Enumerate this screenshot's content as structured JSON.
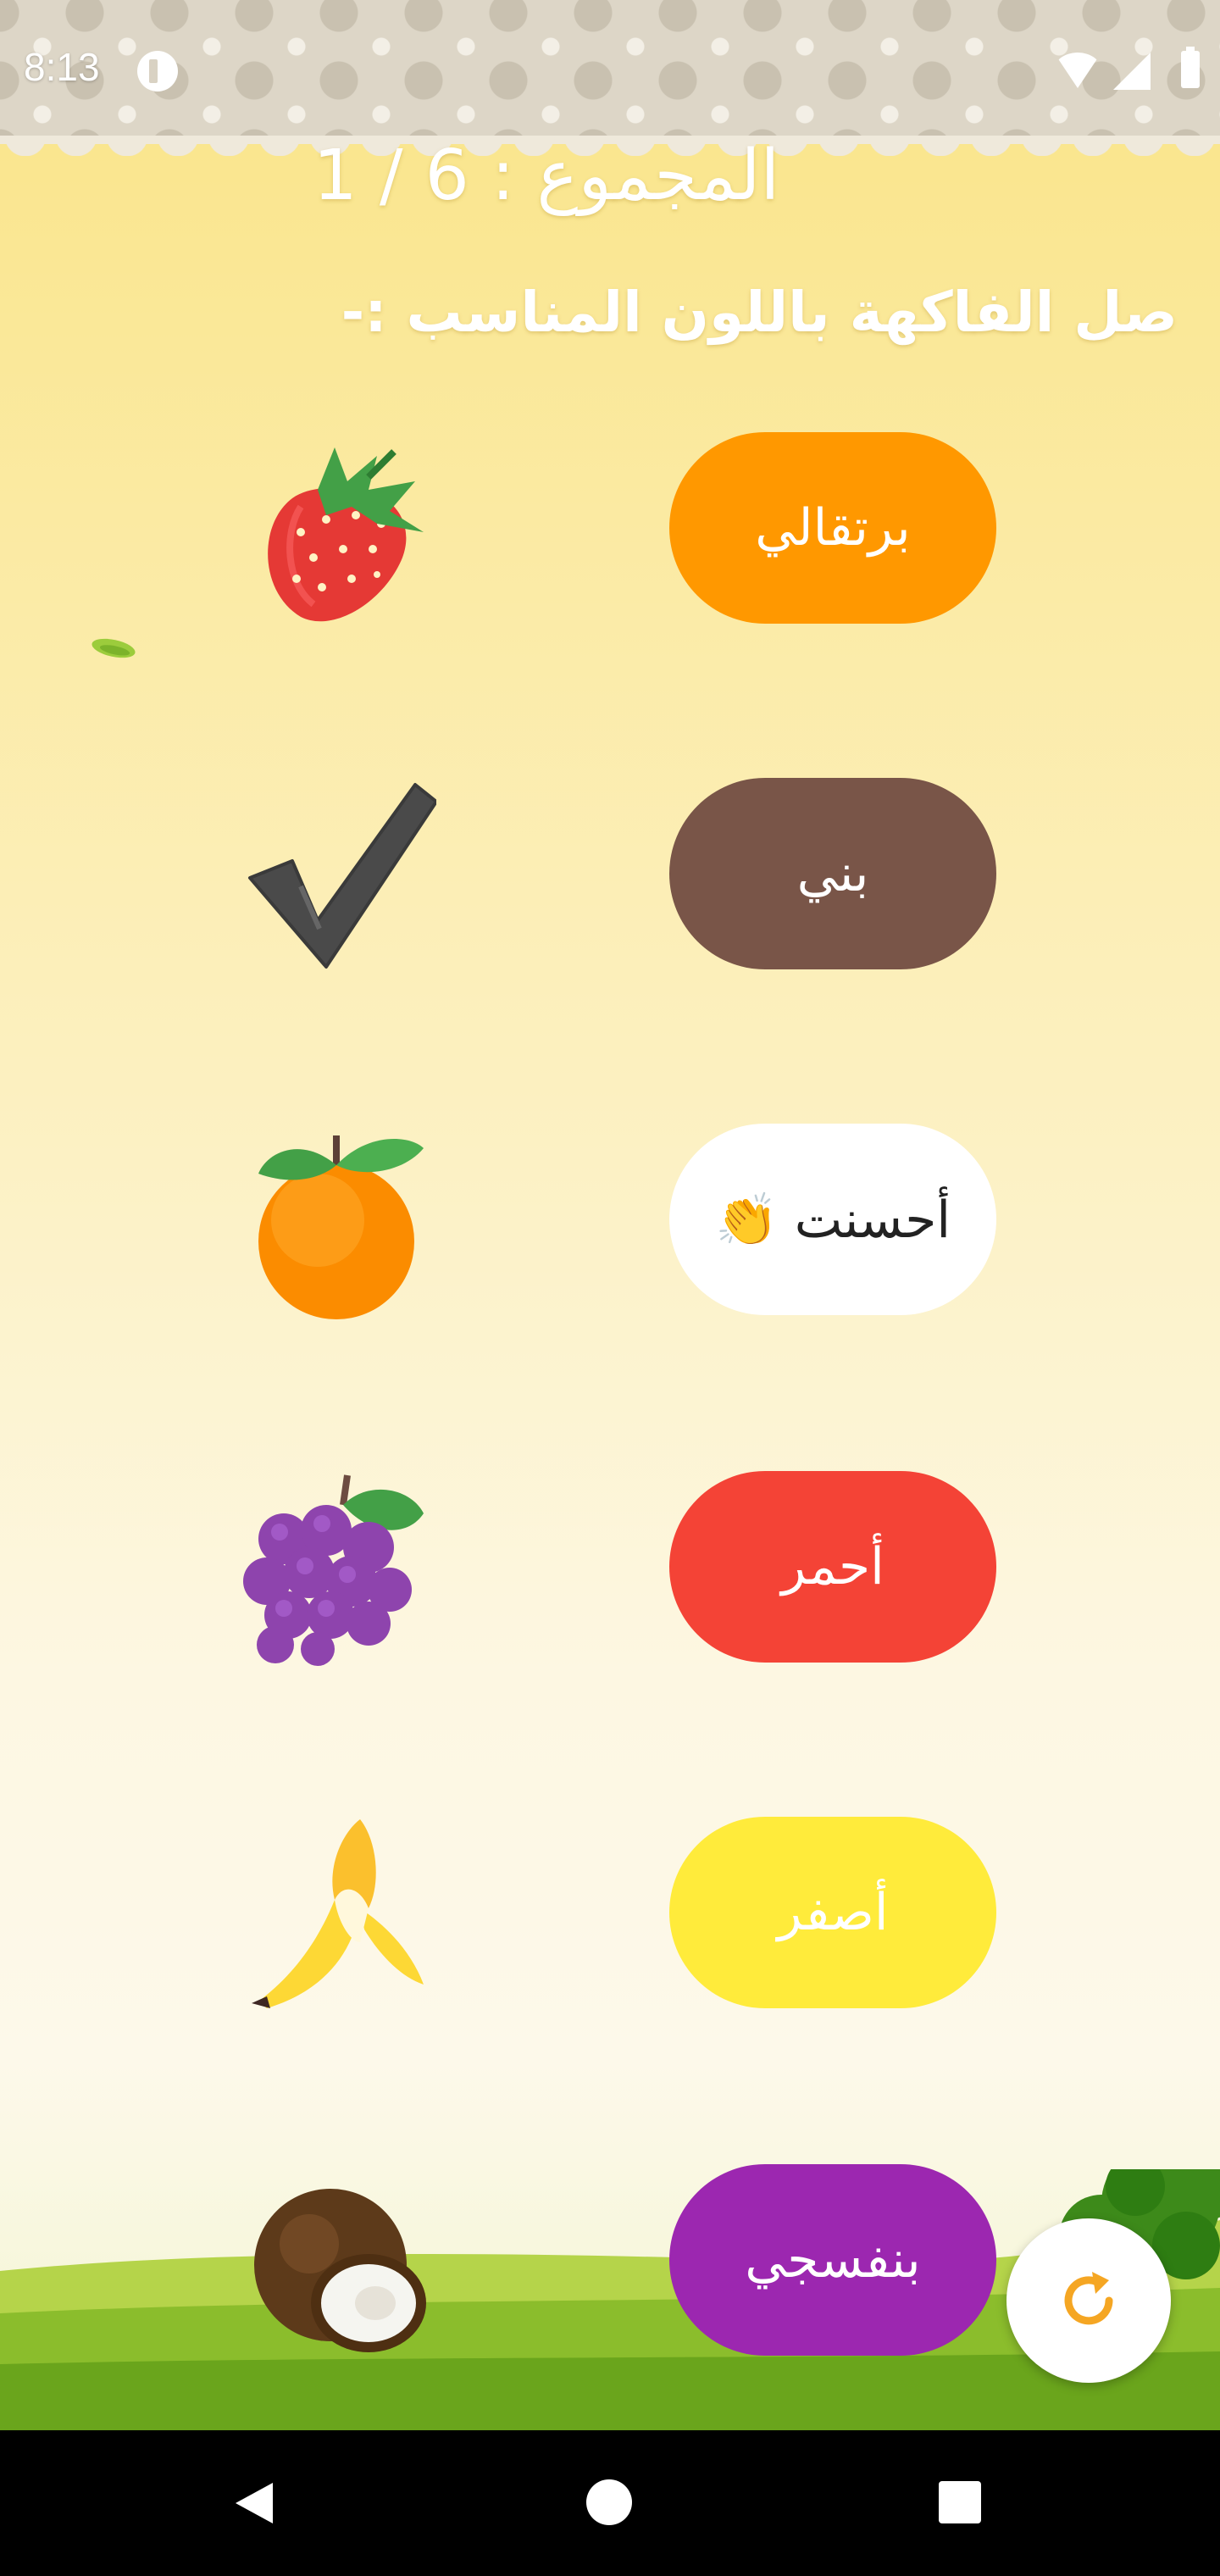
{
  "status_bar": {
    "time": "8:13"
  },
  "header": {
    "score": "1 / 6  :  المجموع",
    "instruction": "صل الفاكهة باللون المناسب :-"
  },
  "rows": [
    {
      "fruit": "strawberry",
      "button_label": "برتقالي",
      "button_color": "#ff9800"
    },
    {
      "fruit": "checkmark",
      "button_label": "بني",
      "button_color": "#795548"
    },
    {
      "fruit": "orange",
      "button_label": "أحسنت 👏",
      "button_color": "#ffffff"
    },
    {
      "fruit": "grapes",
      "button_label": "أحمر",
      "button_color": "#f44336"
    },
    {
      "fruit": "banana",
      "button_label": "أصفر",
      "button_color": "#ffeb3b"
    },
    {
      "fruit": "coconut",
      "button_label": "بنفسجي",
      "button_color": "#9c27b0"
    }
  ],
  "fab": {
    "icon": "refresh-icon",
    "color": "#f5a623"
  },
  "nav": {
    "back": "back-icon",
    "home": "home-icon",
    "recents": "recents-icon"
  }
}
